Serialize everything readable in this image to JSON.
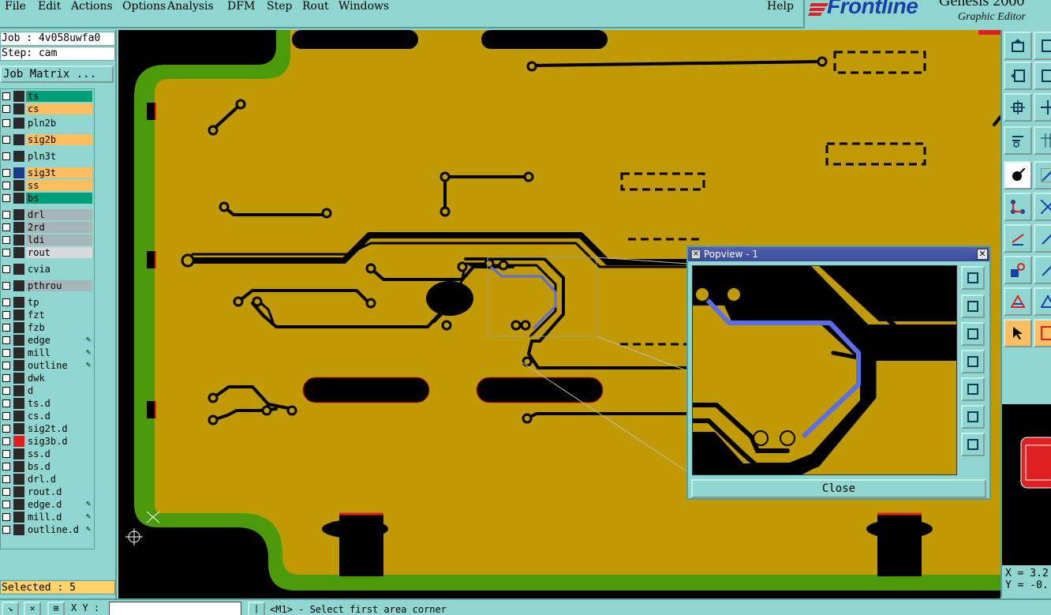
{
  "menu": [
    "File",
    "Edit",
    "Actions",
    "Options",
    "Analysis",
    "DFM",
    "Step",
    "Rout",
    "Windows"
  ],
  "help": "Help",
  "brand": {
    "logo": "Frontline",
    "product": "Genesis 2000",
    "subtitle": "Graphic Editor"
  },
  "job": {
    "label": "Job : 4v058uwfa0",
    "step": "Step: cam"
  },
  "job_matrix": "Job Matrix ...",
  "layers": [
    {
      "name": "ts",
      "color": "#009e78"
    },
    {
      "name": "cs",
      "color": "#ffbf60"
    },
    {
      "name": "pln2b",
      "color": "#8fd6d0"
    },
    {
      "name": "sig2b",
      "color": "#ffbf60"
    },
    {
      "name": "pln3t",
      "color": "#8fd6d0"
    },
    {
      "name": "sig3t",
      "color": "#ffbf60"
    },
    {
      "name": "ss",
      "color": "#ffbf60"
    },
    {
      "name": "bs",
      "color": "#009e78"
    },
    {
      "name": "drl",
      "color": "#a9b6b8"
    },
    {
      "name": "2rd",
      "color": "#a9b6b8"
    },
    {
      "name": "ldi",
      "color": "#a9b6b8"
    },
    {
      "name": "rout",
      "color": "#d9d9d9"
    },
    {
      "name": "cvia",
      "color": "#8fd6d0"
    },
    {
      "name": "pthrou",
      "color": "#a9b6b8"
    },
    {
      "name": "tp",
      "color": "#8fd6d0"
    },
    {
      "name": "fzt",
      "color": "#8fd6d0"
    },
    {
      "name": "fzb",
      "color": "#8fd6d0"
    },
    {
      "name": "edge",
      "color": "#8fd6d0"
    },
    {
      "name": "mill",
      "color": "#8fd6d0"
    },
    {
      "name": "outline",
      "color": "#8fd6d0"
    },
    {
      "name": "dwk",
      "color": "#8fd6d0"
    },
    {
      "name": "d",
      "color": "#8fd6d0"
    },
    {
      "name": "ts.d",
      "color": "#8fd6d0"
    },
    {
      "name": "cs.d",
      "color": "#8fd6d0"
    },
    {
      "name": "sig2t.d",
      "color": "#8fd6d0"
    },
    {
      "name": "sig3b.d",
      "color": "#8fd6d0"
    },
    {
      "name": "ss.d",
      "color": "#8fd6d0"
    },
    {
      "name": "bs.d",
      "color": "#8fd6d0"
    },
    {
      "name": "drl.d",
      "color": "#8fd6d0"
    },
    {
      "name": "rout.d",
      "color": "#8fd6d0"
    },
    {
      "name": "edge.d",
      "color": "#8fd6d0"
    },
    {
      "name": "mill.d",
      "color": "#8fd6d0"
    },
    {
      "name": "outline.d",
      "color": "#8fd6d0"
    }
  ],
  "selected": "Selected : 5",
  "popview": {
    "title": "Popview - 1",
    "close": "Close"
  },
  "coords": {
    "x": "X = 3.2",
    "y": "Y = -0."
  },
  "status": {
    "xy_label": "X Y :",
    "xy_value": "",
    "prompt": "<M1> - Select first area corner"
  },
  "colors": {
    "copper": "#c09a00",
    "board_edge": "#4a9a0a",
    "highlight": "#5a6ee8",
    "panel": "#8fd6d0"
  }
}
